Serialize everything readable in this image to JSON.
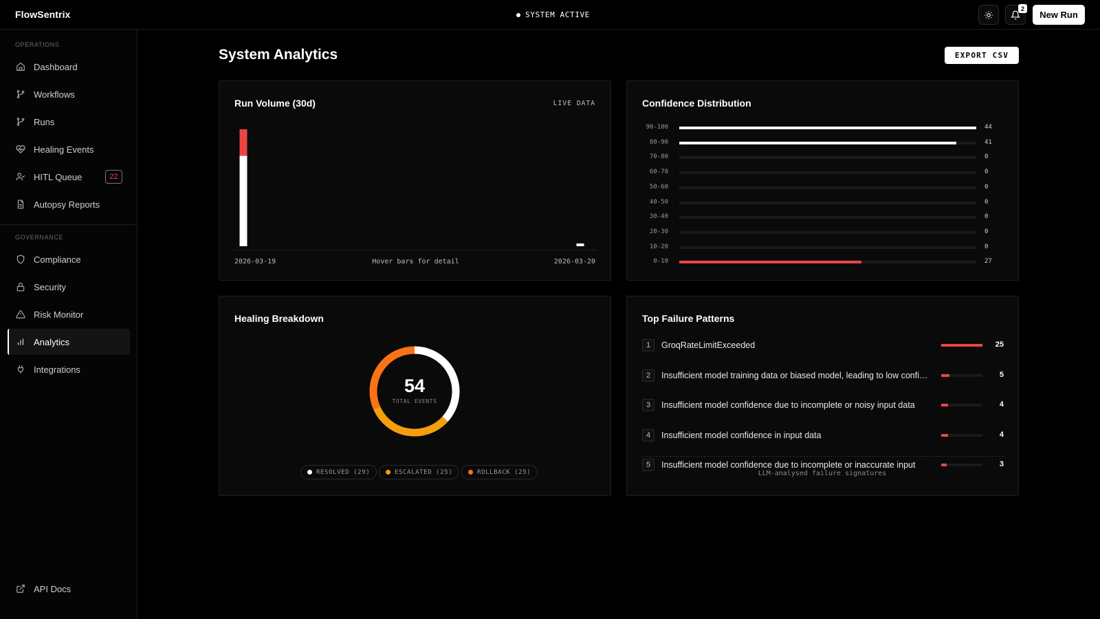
{
  "app": {
    "brand": "FlowSentrix",
    "status": "SYSTEM ACTIVE",
    "new_run_label": "New Run",
    "notification_count": "2"
  },
  "sidebar": {
    "operations_title": "OPERATIONS",
    "governance_title": "GOVERNANCE",
    "items": [
      {
        "label": "Dashboard",
        "icon": "home-icon"
      },
      {
        "label": "Workflows",
        "icon": "branch-icon"
      },
      {
        "label": "Runs",
        "icon": "branch-icon"
      },
      {
        "label": "Healing Events",
        "icon": "heart-pulse-icon"
      },
      {
        "label": "HITL Queue",
        "icon": "user-check-icon",
        "badge": "22"
      },
      {
        "label": "Autopsy Reports",
        "icon": "document-icon"
      },
      {
        "label": "Compliance",
        "icon": "shield-icon"
      },
      {
        "label": "Security",
        "icon": "lock-icon"
      },
      {
        "label": "Risk Monitor",
        "icon": "warning-icon"
      },
      {
        "label": "Analytics",
        "icon": "bar-chart-icon",
        "active": true
      },
      {
        "label": "Integrations",
        "icon": "plug-icon"
      }
    ],
    "footer_link": "API Docs"
  },
  "page": {
    "title": "System Analytics",
    "export_label": "EXPORT CSV"
  },
  "run_volume": {
    "title": "Run Volume (30d)",
    "badge": "LIVE DATA",
    "start_date": "2026-03-19",
    "end_date": "2026-03-20",
    "hint": "Hover bars for detail"
  },
  "confidence": {
    "title": "Confidence Distribution",
    "accent_color": "#ef4444"
  },
  "healing": {
    "title": "Healing Breakdown",
    "total": "54",
    "total_label": "TOTAL EVENTS",
    "legend": [
      {
        "label": "RESOLVED (29)",
        "color": "#ffffff"
      },
      {
        "label": "ESCALATED (25)",
        "color": "#f59e0b"
      },
      {
        "label": "ROLLBACK (25)",
        "color": "#f97316"
      }
    ]
  },
  "failures": {
    "title": "Top Failure Patterns",
    "footer": "LLM-analysed failure signatures",
    "items": [
      {
        "rank": "1",
        "name": "GroqRateLimitExceeded",
        "count": "25"
      },
      {
        "rank": "2",
        "name": "Insufficient model training data or biased model, leading to low confidence scores",
        "count": "5"
      },
      {
        "rank": "3",
        "name": "Insufficient model confidence due to incomplete or noisy input data",
        "count": "4"
      },
      {
        "rank": "4",
        "name": "Insufficient model confidence in input data",
        "count": "4"
      },
      {
        "rank": "5",
        "name": "Insufficient model confidence due to incomplete or inaccurate input",
        "count": "3"
      }
    ]
  },
  "chart_data": [
    {
      "type": "bar",
      "title": "Run Volume (30d)",
      "categories": [
        "2026-03-19",
        "2026-03-20"
      ],
      "series": [
        {
          "values": [
            58,
            1
          ],
          "color": "#ffffff"
        },
        {
          "values": [
            17,
            0
          ],
          "color": "#ef4444"
        }
      ]
    },
    {
      "type": "bar",
      "title": "Confidence Distribution",
      "categories": [
        "90-100",
        "80-90",
        "70-80",
        "60-70",
        "50-60",
        "40-50",
        "30-40",
        "20-30",
        "10-20",
        "0-10"
      ],
      "values": [
        44,
        41,
        0,
        0,
        0,
        0,
        0,
        0,
        0,
        27
      ],
      "xlim": [
        0,
        44
      ]
    },
    {
      "type": "pie",
      "title": "Healing Breakdown",
      "categories": [
        "RESOLVED",
        "ESCALATED",
        "ROLLBACK"
      ],
      "values": [
        29,
        25,
        25
      ],
      "colors": [
        "#ffffff",
        "#f59e0b",
        "#f97316"
      ]
    },
    {
      "type": "bar",
      "title": "Top Failure Patterns",
      "categories": [
        "GroqRateLimitExceeded",
        "Insufficient model training data or biased model, leading to low confidence scores",
        "Insufficient model confidence due to incomplete or noisy input data",
        "Insufficient model confidence in input data",
        "Insufficient model confidence due to incomplete or inaccurate input"
      ],
      "values": [
        25,
        5,
        4,
        4,
        3
      ]
    }
  ]
}
